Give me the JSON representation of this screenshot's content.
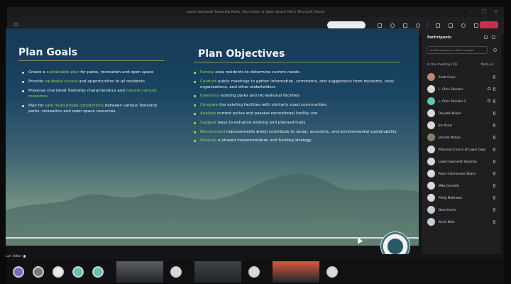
{
  "window": {
    "title": "Lower Gwynedd Township Parks, Recreation & Open Space Plan | Microsoft Teams"
  },
  "toolbar": {
    "pill_label": "",
    "icons": [
      "people-icon",
      "chat-icon",
      "raise-hand-icon",
      "reactions-icon",
      "more-icon",
      "camera-icon",
      "mic-icon",
      "share-icon"
    ],
    "leave_color": "#c4314b"
  },
  "slide": {
    "goals_heading": "Plan Goals",
    "objectives_heading": "Plan Objectives",
    "goals": [
      {
        "pre": "Create a ",
        "hl": "sustainable plan",
        "post": " for parks, recreation and open space"
      },
      {
        "pre": "Provide ",
        "hl": "equitable access",
        "post": " and opportunities to all residents"
      },
      {
        "pre": "Preserve cherished Township characteristics and ",
        "hl": "natural cultural resources",
        "post": ""
      },
      {
        "pre": "Plan for ",
        "hl": "safe multi-modal connections",
        "post": " between various Township parks, recreation and open space resources"
      }
    ],
    "objectives": [
      {
        "hl": "Survey",
        "post": " area residents to determine current needs"
      },
      {
        "hl": "Conduct",
        "post": " public meetings to gather information, comments, and suggestions from residents, local organizations, and other stakeholders"
      },
      {
        "hl": "Inventory",
        "post": " existing parks and recreational facilities"
      },
      {
        "hl": "Compare",
        "post": " the existing facilities with similarly sized communities"
      },
      {
        "hl": "Analyze",
        "post": " current active and passive recreational facility use"
      },
      {
        "hl": "Suggest",
        "post": " ways to enhance existing and planned trails"
      },
      {
        "hl": "Recommend",
        "post": " improvements which contribute to social, economic, and environmental sustainability"
      },
      {
        "hl": "Develop",
        "post": " a phased implementation and funding strategy"
      }
    ],
    "accent_color": "#9bd35c"
  },
  "sharer": {
    "label": "Lori Hiller"
  },
  "panel": {
    "title": "Participants",
    "search_placeholder": "Invite someone or dial a number",
    "section_label": "In this meeting (16)",
    "section_action": "Mute all",
    "participants": [
      {
        "name": "Scott Cross",
        "color": "#b88a7a"
      },
      {
        "name": "L. Chris Strickler",
        "color": "#d9d9d9"
      },
      {
        "name": "L. Chris Strickler 2",
        "color": "#5ec7b4"
      },
      {
        "name": "Danielle Wilson",
        "color": "#d9d9d9"
      },
      {
        "name": "Jim Parisi",
        "color": "#d9d9d9"
      },
      {
        "name": "Jennifer Wilson",
        "color": "#8a7d66"
      },
      {
        "name": "Planning Cmmsn of Lower Gwynedd",
        "color": "#d9d9d9"
      },
      {
        "name": "Lower Gwynedd Township",
        "color": "#d9d9d9"
      },
      {
        "name": "Parks Commission Board",
        "color": "#d9d9d9"
      },
      {
        "name": "Mike Connelly",
        "color": "#d9d9d9"
      },
      {
        "name": "Philip Matthews",
        "color": "#d9d9d9"
      },
      {
        "name": "Dave Harris",
        "color": "#c6cdd6"
      },
      {
        "name": "Kevin Wise",
        "color": "#c6cdd6"
      }
    ]
  },
  "strip": {
    "tiles": [
      {
        "kind": "dot",
        "color": "#6f6fc6"
      },
      {
        "kind": "dot",
        "color": "#7a7a7a"
      },
      {
        "kind": "dot",
        "color": "#e9e9e9"
      },
      {
        "kind": "dot",
        "color": "#5ec7b4"
      },
      {
        "kind": "dot",
        "color": "#5ec7b4"
      },
      {
        "kind": "video",
        "color": "#5b5f62"
      },
      {
        "kind": "dot",
        "color": "#d9d9d9"
      },
      {
        "kind": "video",
        "color": "#3e444a"
      },
      {
        "kind": "dot",
        "color": "#d9d9d9"
      },
      {
        "kind": "video",
        "color": "#d9583f"
      },
      {
        "kind": "dot",
        "color": "#d9d9d9"
      }
    ]
  }
}
